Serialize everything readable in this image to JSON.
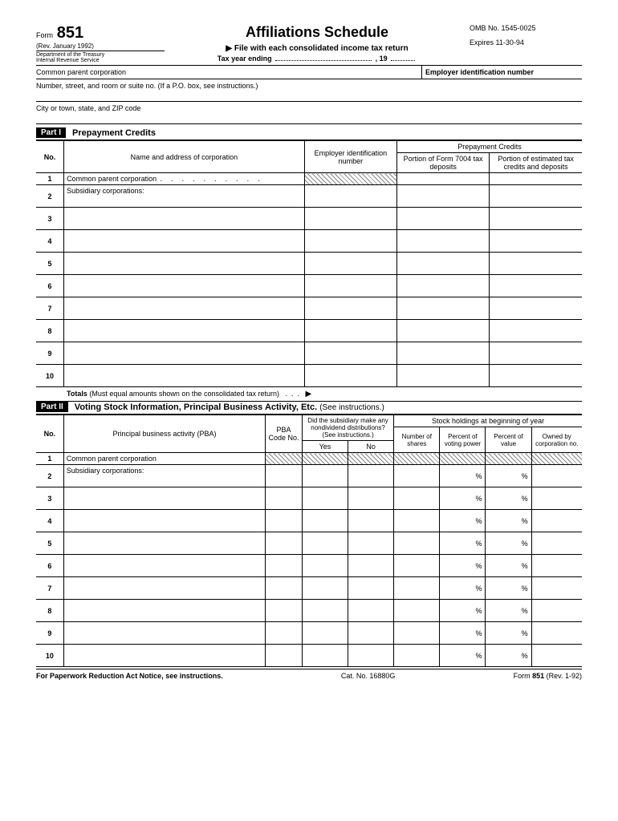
{
  "header": {
    "form_label": "Form",
    "form_number": "851",
    "rev": "(Rev. January 1992)",
    "dept1": "Department of the Treasury",
    "dept2": "Internal Revenue Service",
    "title": "Affiliations Schedule",
    "subtitle": "File with each consolidated income tax return",
    "tax_year_label": "Tax year ending",
    "tax_year_suffix": ", 19",
    "omb": "OMB No. 1545-0025",
    "expires": "Expires 11-30-94"
  },
  "labels": {
    "common_parent": "Common parent corporation",
    "ein_header": "Employer identification number",
    "address": "Number, street, and room or suite no. (If a P.O. box, see instructions.)",
    "city": "City or town, state, and ZIP code"
  },
  "part1": {
    "badge": "Part I",
    "title": "Prepayment Credits",
    "col_no": "No.",
    "col_name": "Name and address of corporation",
    "col_ein": "Employer identification number",
    "col_prepay": "Prepayment Credits",
    "col_7004": "Portion of Form 7004 tax deposits",
    "col_est": "Portion of estimated tax credits and deposits",
    "row1_text": "Common parent corporation",
    "row2_text": "Subsidiary corporations:",
    "rows": [
      "1",
      "2",
      "3",
      "4",
      "5",
      "6",
      "7",
      "8",
      "9",
      "10"
    ],
    "totals_label": "Totals",
    "totals_note": "(Must equal amounts shown on the consolidated tax return)"
  },
  "part2": {
    "badge": "Part II",
    "title": "Voting Stock Information, Principal Business Activity, Etc.",
    "note": "(See instructions.)",
    "col_no": "No.",
    "col_pba": "Principal business activity (PBA)",
    "col_pba_code": "PBA Code No.",
    "col_did_sub": "Did the subsidiary make any nondividend distributions? (See instructions.)",
    "col_yes": "Yes",
    "col_no2": "No",
    "col_stock": "Stock holdings at beginning of year",
    "col_shares": "Number of shares",
    "col_voting": "Percent of voting power",
    "col_value": "Percent of value",
    "col_owned": "Owned by corporation no.",
    "row1_text": "Common parent corporation",
    "row2_text": "Subsidiary corporations:",
    "rows": [
      "1",
      "2",
      "3",
      "4",
      "5",
      "6",
      "7",
      "8",
      "9",
      "10"
    ],
    "pct": "%"
  },
  "footer": {
    "left": "For Paperwork Reduction Act Notice, see instructions.",
    "center": "Cat. No. 16880G",
    "right_form": "Form",
    "right_num": "851",
    "right_rev": "(Rev. 1-92)"
  }
}
